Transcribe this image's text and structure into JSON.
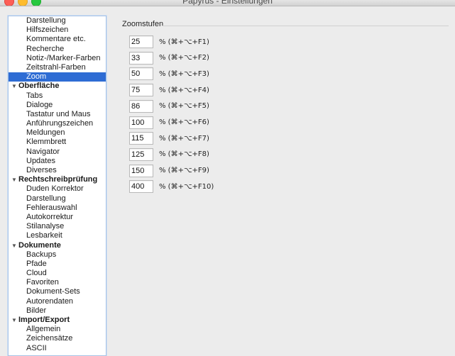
{
  "window": {
    "title": "Papyrus - Einstellungen"
  },
  "sidebar": {
    "rows": [
      {
        "type": "item",
        "label": "Darstellung"
      },
      {
        "type": "item",
        "label": "Hilfszeichen"
      },
      {
        "type": "item",
        "label": "Kommentare etc."
      },
      {
        "type": "item",
        "label": "Recherche"
      },
      {
        "type": "item",
        "label": "Notiz-/Marker-Farben"
      },
      {
        "type": "item",
        "label": "Zeitstrahl-Farben"
      },
      {
        "type": "item",
        "label": "Zoom",
        "selected": true
      },
      {
        "type": "group",
        "label": "Oberfläche"
      },
      {
        "type": "item",
        "label": "Tabs"
      },
      {
        "type": "item",
        "label": "Dialoge"
      },
      {
        "type": "item",
        "label": "Tastatur und Maus"
      },
      {
        "type": "item",
        "label": "Anführungszeichen"
      },
      {
        "type": "item",
        "label": "Meldungen"
      },
      {
        "type": "item",
        "label": "Klemmbrett"
      },
      {
        "type": "item",
        "label": "Navigator"
      },
      {
        "type": "item",
        "label": "Updates"
      },
      {
        "type": "item",
        "label": "Diverses"
      },
      {
        "type": "group",
        "label": "Rechtschreibprüfung"
      },
      {
        "type": "item",
        "label": "Duden Korrektor"
      },
      {
        "type": "item",
        "label": "Darstellung"
      },
      {
        "type": "item",
        "label": "Fehlerauswahl"
      },
      {
        "type": "item",
        "label": "Autokorrektur"
      },
      {
        "type": "item",
        "label": "Stilanalyse"
      },
      {
        "type": "item",
        "label": "Lesbarkeit"
      },
      {
        "type": "group",
        "label": "Dokumente"
      },
      {
        "type": "item",
        "label": "Backups"
      },
      {
        "type": "item",
        "label": "Pfade"
      },
      {
        "type": "item",
        "label": "Cloud"
      },
      {
        "type": "item",
        "label": "Favoriten"
      },
      {
        "type": "item",
        "label": "Dokument-Sets"
      },
      {
        "type": "item",
        "label": "Autorendaten"
      },
      {
        "type": "item",
        "label": "Bilder"
      },
      {
        "type": "group",
        "label": "Import/Export"
      },
      {
        "type": "item",
        "label": "Allgemein"
      },
      {
        "type": "item",
        "label": "Zeichensätze"
      },
      {
        "type": "item",
        "label": "ASCII"
      }
    ]
  },
  "zoom": {
    "section_title": "Zoomstufen",
    "levels": [
      {
        "value": "25",
        "shortcut": "% (⌘+⌥+F1)"
      },
      {
        "value": "33",
        "shortcut": "% (⌘+⌥+F2)"
      },
      {
        "value": "50",
        "shortcut": "% (⌘+⌥+F3)"
      },
      {
        "value": "75",
        "shortcut": "% (⌘+⌥+F4)"
      },
      {
        "value": "86",
        "shortcut": "% (⌘+⌥+F5)"
      },
      {
        "value": "100",
        "shortcut": "% (⌘+⌥+F6)"
      },
      {
        "value": "115",
        "shortcut": "% (⌘+⌥+F7)"
      },
      {
        "value": "125",
        "shortcut": "% (⌘+⌥+F8)"
      },
      {
        "value": "150",
        "shortcut": "% (⌘+⌥+F9)"
      },
      {
        "value": "400",
        "shortcut": "% (⌘+⌥+F10)"
      }
    ]
  },
  "colors": {
    "selection": "#2e6cd4",
    "background": "#ececec"
  }
}
